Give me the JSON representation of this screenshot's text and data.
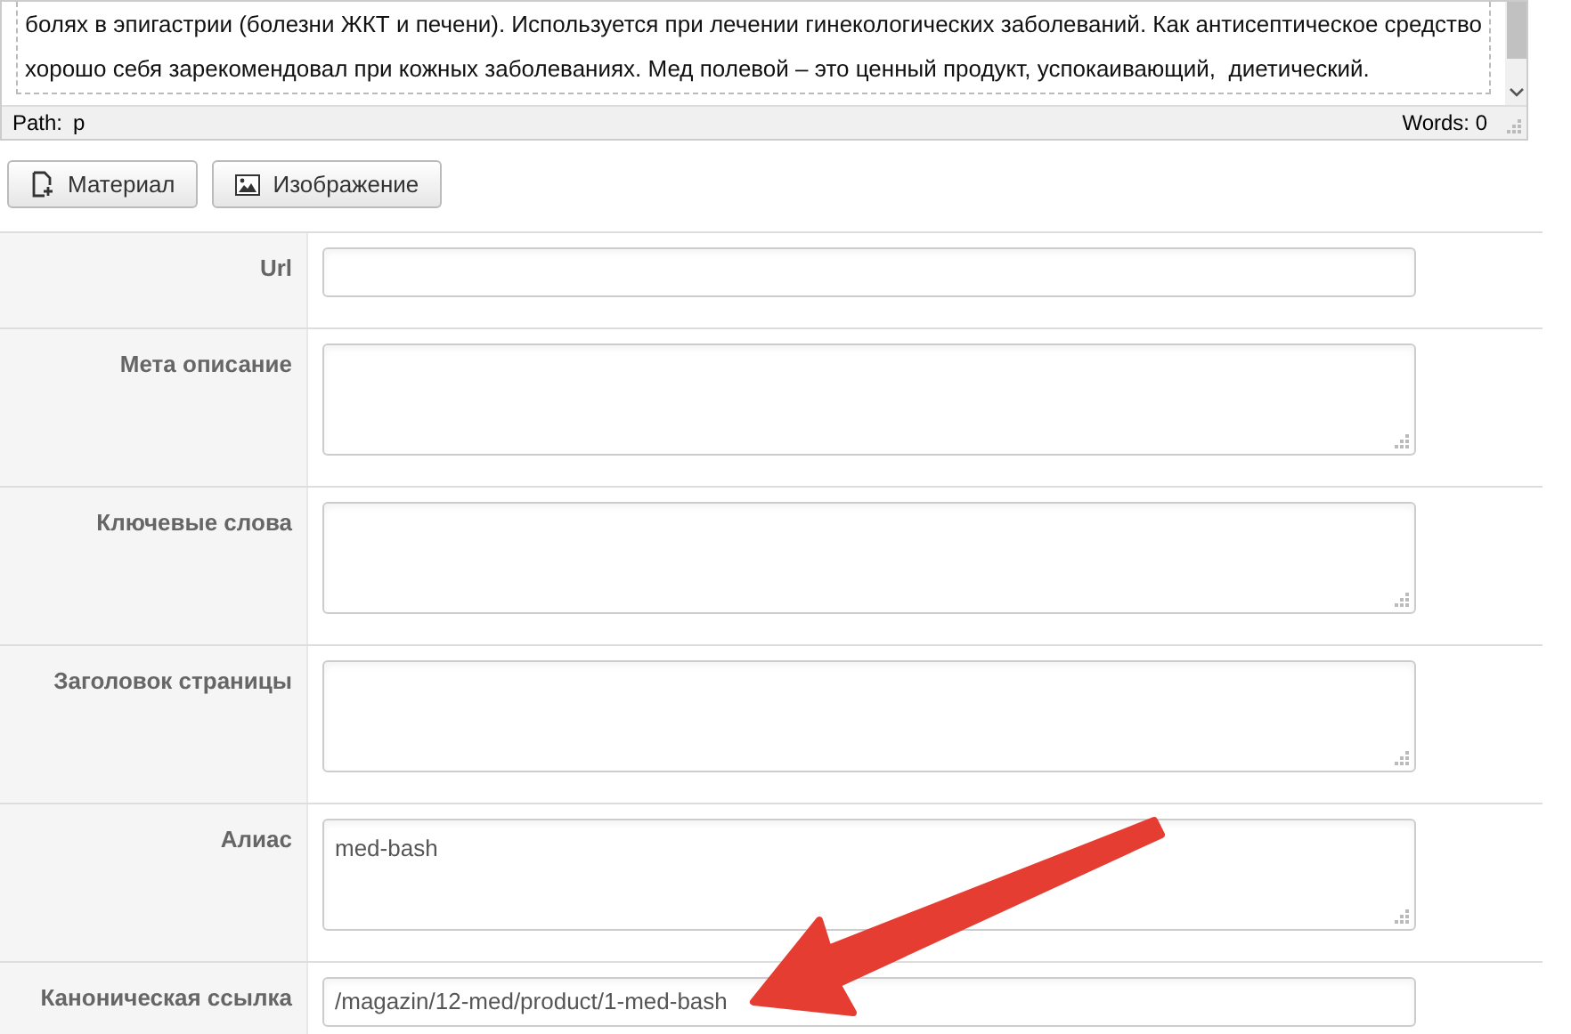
{
  "editor": {
    "lines": [
      "болях в эпигастрии (болезни ЖКТ и печени). Используется при лечении гинекологических заболеваний. Как антисептическое средство",
      "хорошо себя зарекомендовал при кожных заболеваниях. Мед полевой – это ценный продукт, успокаивающий,  диетический."
    ],
    "path_label": "Path:",
    "path": "p",
    "words": "Words: 0"
  },
  "buttons": [
    {
      "kind": "article",
      "label": "Материал"
    },
    {
      "kind": "image",
      "label": "Изображение"
    }
  ],
  "fields": [
    {
      "label": "Url",
      "kind": "input"
    },
    {
      "label": "Мета описание",
      "kind": "textarea"
    },
    {
      "label": "Ключевые слова",
      "kind": "textarea"
    },
    {
      "label": "Заголовок страницы",
      "kind": "textarea"
    },
    {
      "label": "Алиас",
      "kind": "textarea",
      "value": "med-bash"
    },
    {
      "label": "Каноническая ссылка",
      "kind": "input",
      "value": "/magazin/12-med/product/1-med-bash"
    }
  ]
}
